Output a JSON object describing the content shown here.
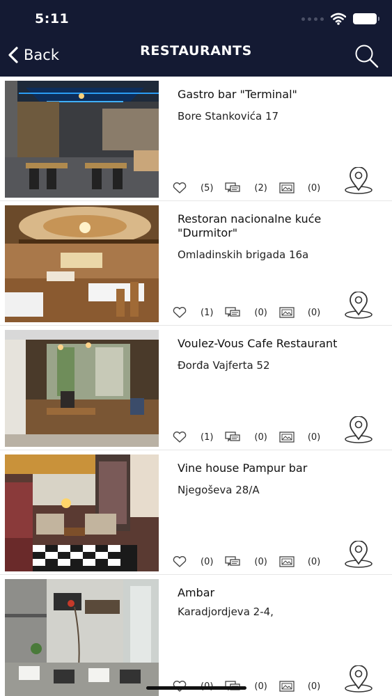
{
  "status_bar": {
    "time": "5:11"
  },
  "header": {
    "back_label": "Back",
    "title": "RESTAURANTS"
  },
  "restaurants": [
    {
      "name": "Gastro bar \"Terminal\"",
      "address": "Bore Stankovića 17",
      "likes": "(5)",
      "comments": "(2)",
      "photos": "(0)"
    },
    {
      "name": "Restoran nacionalne kuće \"Durmitor\"",
      "address": "Omladinskih brigada 16a",
      "likes": "(1)",
      "comments": "(0)",
      "photos": "(0)"
    },
    {
      "name": "Voulez-Vous Cafe Restaurant",
      "address": "Đorđa Vajferta 52",
      "likes": "(1)",
      "comments": "(0)",
      "photos": "(0)"
    },
    {
      "name": "Vine house Pampur bar",
      "address": "Njegoševa 28/A",
      "likes": "(0)",
      "comments": "(0)",
      "photos": "(0)"
    },
    {
      "name": "Ambar",
      "address": "Karadjordjeva 2-4,",
      "likes": "(0)",
      "comments": "(0)",
      "photos": "(0)"
    }
  ],
  "icons": {
    "back": "chevron-left-icon",
    "search": "search-icon",
    "like": "heart-icon",
    "comments": "comments-icon",
    "photos": "photo-icon",
    "map": "map-pin-icon"
  },
  "colors": {
    "header_bg": "#141a33",
    "text": "#111111"
  }
}
